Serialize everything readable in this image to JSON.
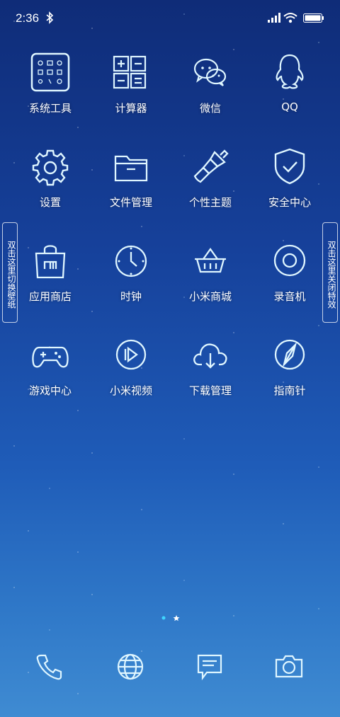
{
  "status_bar": {
    "time": "2:36",
    "icons": [
      "bluetooth-icon",
      "signal-icon",
      "wifi-icon",
      "battery-icon"
    ]
  },
  "apps": [
    {
      "label": "系统工具",
      "icon": "folder-tools-icon"
    },
    {
      "label": "计算器",
      "icon": "calculator-icon"
    },
    {
      "label": "微信",
      "icon": "wechat-icon"
    },
    {
      "label": "QQ",
      "icon": "qq-icon"
    },
    {
      "label": "设置",
      "icon": "gear-icon"
    },
    {
      "label": "文件管理",
      "icon": "folder-icon"
    },
    {
      "label": "个性主题",
      "icon": "brush-icon"
    },
    {
      "label": "安全中心",
      "icon": "shield-icon"
    },
    {
      "label": "应用商店",
      "icon": "store-bag-icon"
    },
    {
      "label": "时钟",
      "icon": "clock-icon"
    },
    {
      "label": "小米商城",
      "icon": "basket-icon"
    },
    {
      "label": "录音机",
      "icon": "recorder-icon"
    },
    {
      "label": "游戏中心",
      "icon": "gamepad-icon"
    },
    {
      "label": "小米视频",
      "icon": "video-play-icon"
    },
    {
      "label": "下载管理",
      "icon": "cloud-download-icon"
    },
    {
      "label": "指南针",
      "icon": "compass-icon"
    }
  ],
  "side_buttons": {
    "left": "双击这里切换壁纸",
    "right": "双击这里关闭特效"
  },
  "page_indicator": {
    "current": 2,
    "total": 2
  },
  "dock": [
    "phone-icon",
    "browser-globe-icon",
    "messages-icon",
    "camera-icon"
  ],
  "colors": {
    "accent": "#8fe8ff",
    "icon_stroke": "#dff6ff"
  }
}
